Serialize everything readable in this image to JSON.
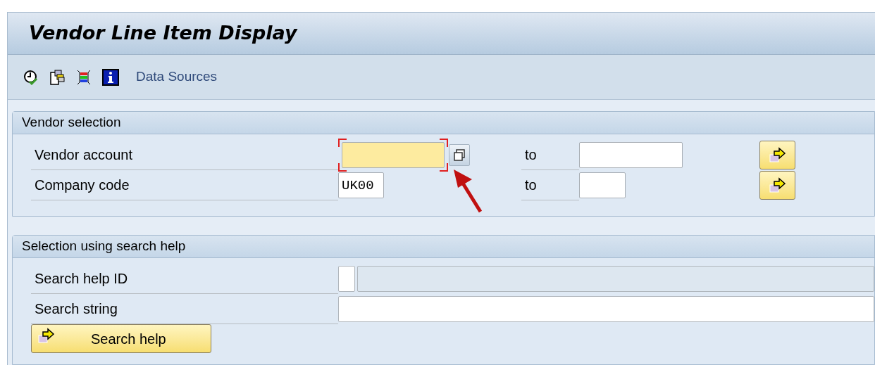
{
  "window": {
    "title": "Vendor Line Item Display"
  },
  "toolbar": {
    "icons": [
      {
        "kind": "execute"
      },
      {
        "kind": "variant"
      },
      {
        "kind": "selections"
      },
      {
        "kind": "info"
      }
    ],
    "link": "Data Sources"
  },
  "groups": [
    {
      "title": "Vendor selection",
      "rows": [
        {
          "kind": "range",
          "label": "Vendor account",
          "value": "",
          "required": true,
          "focused": true,
          "multi_select": true,
          "to_label": "to",
          "to_value": ""
        },
        {
          "kind": "range",
          "label": "Company code",
          "value": "UK00",
          "required": false,
          "focused": false,
          "multi_select": false,
          "to_label": "to",
          "to_value": ""
        }
      ]
    },
    {
      "title": "Selection using search help",
      "rows": [
        {
          "kind": "id",
          "label": "Search help ID",
          "value": ""
        },
        {
          "kind": "text",
          "label": "Search string",
          "value": ""
        },
        {
          "kind": "button",
          "label": "Search help"
        }
      ]
    }
  ]
}
